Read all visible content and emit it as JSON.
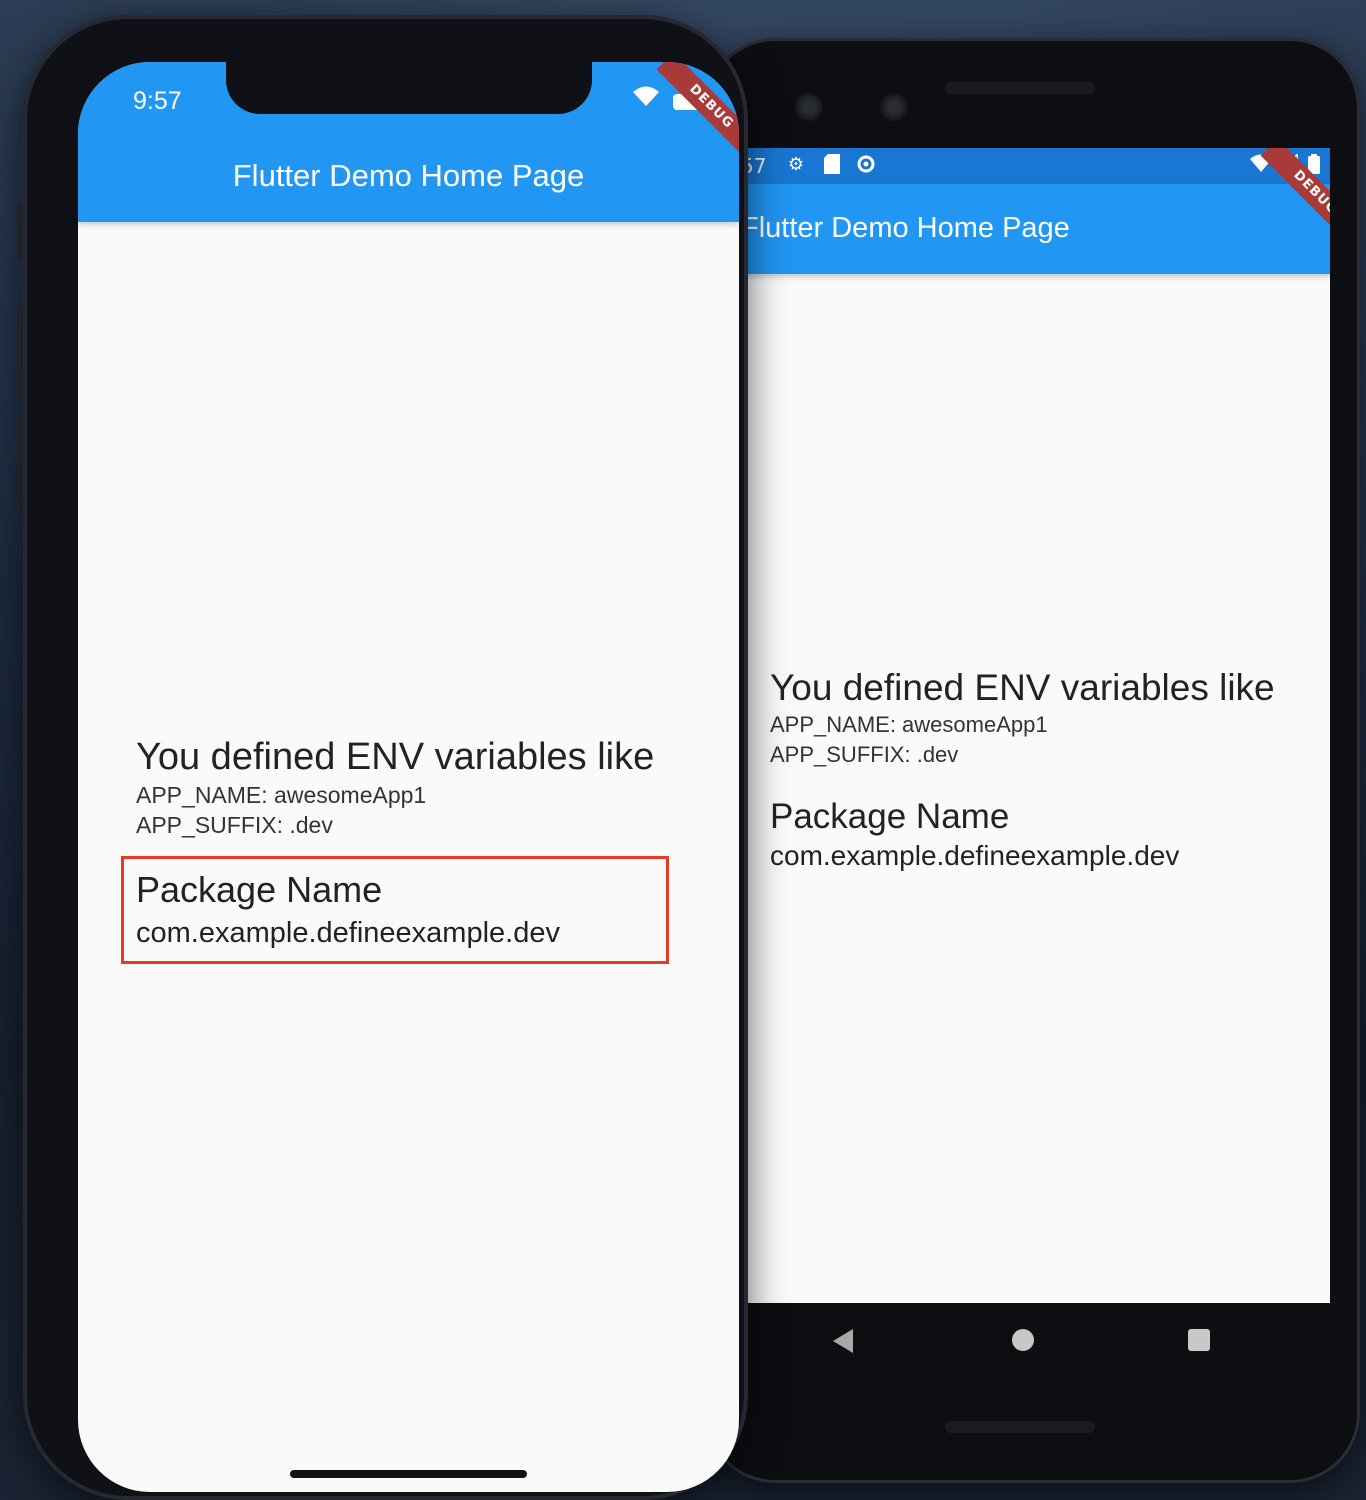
{
  "iphone": {
    "status": {
      "time": "9:57",
      "wifi_icon": "wifi-icon",
      "battery_icon": "battery-icon"
    },
    "appbar": {
      "title": "Flutter Demo Home Page"
    },
    "debug_banner": "DEBUG",
    "body": {
      "heading": "You defined ENV variables like",
      "app_name": "APP_NAME: awesomeApp1",
      "app_suffix": "APP_SUFFIX: .dev",
      "package_title": "Package Name",
      "package_value": "com.example.defineexample.dev"
    },
    "highlight_color": "#e53a26"
  },
  "android": {
    "status": {
      "time": "57",
      "icons": [
        "gear-icon",
        "sd-card-icon",
        "sync-icon",
        "wifi-icon",
        "signal-icon",
        "battery-icon"
      ]
    },
    "appbar": {
      "title": "Flutter Demo Home Page"
    },
    "debug_banner": "DEBUG",
    "body": {
      "heading": "You defined ENV variables like",
      "app_name": "APP_NAME: awesomeApp1",
      "app_suffix": "APP_SUFFIX: .dev",
      "package_title": "Package Name",
      "package_value": "com.example.defineexample.dev"
    },
    "nav": [
      "back-icon",
      "home-icon",
      "recents-icon"
    ]
  },
  "colors": {
    "appbar": "#2196f3",
    "status_bar_android": "#1976d2",
    "debug_banner": "#a83a3a"
  }
}
